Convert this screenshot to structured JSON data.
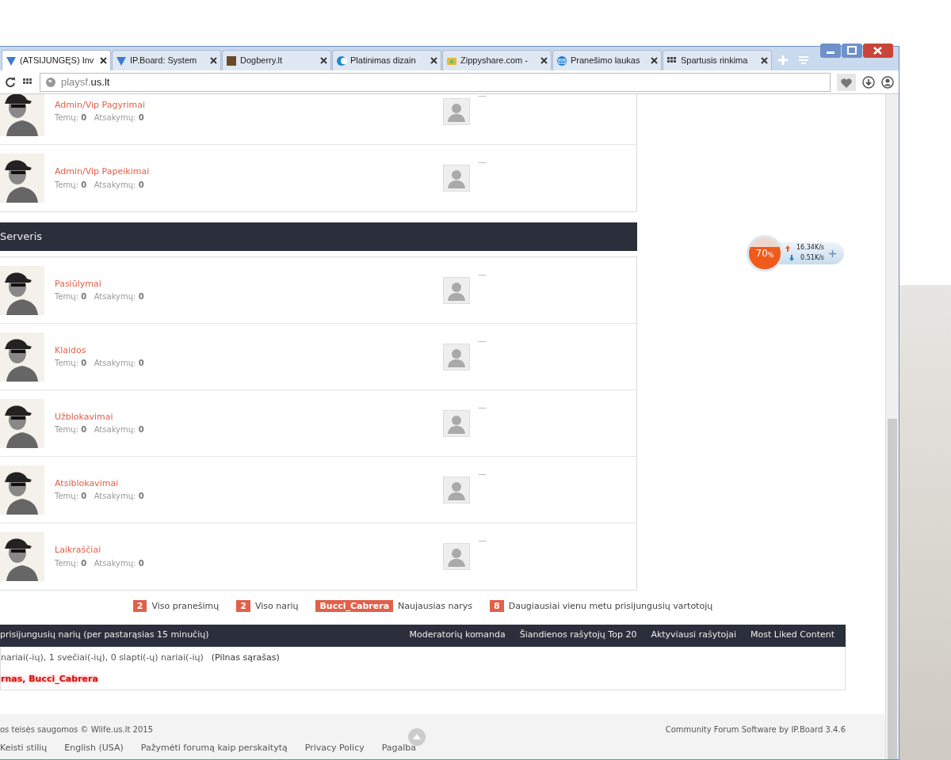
{
  "browser": {
    "tabs": [
      {
        "title": "(ATSIJUNGĘS) Inv",
        "selected": true,
        "kind": "ipb"
      },
      {
        "title": "IP.Board: System",
        "selected": false,
        "kind": "ipb"
      },
      {
        "title": "Dogberry.lt",
        "selected": false,
        "kind": "photo"
      },
      {
        "title": "Platinimas dizain",
        "selected": false,
        "kind": "moon"
      },
      {
        "title": "Zippyshare.com -",
        "selected": false,
        "kind": "zip"
      },
      {
        "title": "Pranešimo laukas",
        "selected": false,
        "kind": "mail"
      },
      {
        "title": "Spartusis rinkima",
        "selected": false,
        "kind": "grid"
      }
    ],
    "address": {
      "subdomain": "playsf.",
      "domain": "us.lt"
    }
  },
  "sections": [
    {
      "forums": [
        {
          "name": "Admin/Vip Pagyrimai",
          "topics_label": "Temų:",
          "topics": "0",
          "replies_label": "Atsakymų:",
          "replies": "0",
          "last_post": "—"
        },
        {
          "name": "Admin/Vip Papeikimai",
          "topics_label": "Temų:",
          "topics": "0",
          "replies_label": "Atsakymų:",
          "replies": "0",
          "last_post": "—"
        }
      ]
    },
    {
      "title": "Serveris",
      "forums": [
        {
          "name": "Pasiūlymai",
          "topics_label": "Temų:",
          "topics": "0",
          "replies_label": "Atsakymų:",
          "replies": "0",
          "last_post": "—"
        },
        {
          "name": "Klaidos",
          "topics_label": "Temų:",
          "topics": "0",
          "replies_label": "Atsakymų:",
          "replies": "0",
          "last_post": "—"
        },
        {
          "name": "Užblokavimai",
          "topics_label": "Temų:",
          "topics": "0",
          "replies_label": "Atsakymų:",
          "replies": "0",
          "last_post": "—"
        },
        {
          "name": "Atsiblokavimai",
          "topics_label": "Temų:",
          "topics": "0",
          "replies_label": "Atsakymų:",
          "replies": "0",
          "last_post": "—"
        },
        {
          "name": "Laikraščiai",
          "topics_label": "Temų:",
          "topics": "0",
          "replies_label": "Atsakymų:",
          "replies": "0",
          "last_post": "—"
        }
      ]
    }
  ],
  "stats": [
    {
      "value": "2",
      "label": "Viso pranešimų"
    },
    {
      "value": "2",
      "label": "Viso narių"
    },
    {
      "value": "Bucci_Cabrera",
      "label": "Naujausias narys"
    },
    {
      "value": "8",
      "label": "Daugiausiai vienu metu prisijungusių vartotojų"
    }
  ],
  "online": {
    "title": "prisijungusių narių (per pastarąsias 15 minučių)",
    "links": [
      "Moderatorių komanda",
      "Šiandienos rašytojų Top 20",
      "Aktyviausi rašytojai",
      "Most Liked Content"
    ],
    "summary": "nariai(-ių), 1 svečiai(-ių), 0 slapti(-ų) nariai(-ių)",
    "full_list": "(Pilnas sąrašas)",
    "members": "rnas, Bucci_Cabrera"
  },
  "footer": {
    "copyright": "os teisės saugomos © Wlife.us.lt 2015",
    "links": [
      "Keisti stilių",
      "English (USA)",
      "Pažymėti forumą kaip perskaitytą",
      "Privacy Policy",
      "Pagalba"
    ],
    "credit": "Community Forum Software by IP.Board 3.4.6"
  },
  "traffic": {
    "percent": "70",
    "unit": "%",
    "upload": "16.34K/s",
    "download": "0.51K/s"
  }
}
